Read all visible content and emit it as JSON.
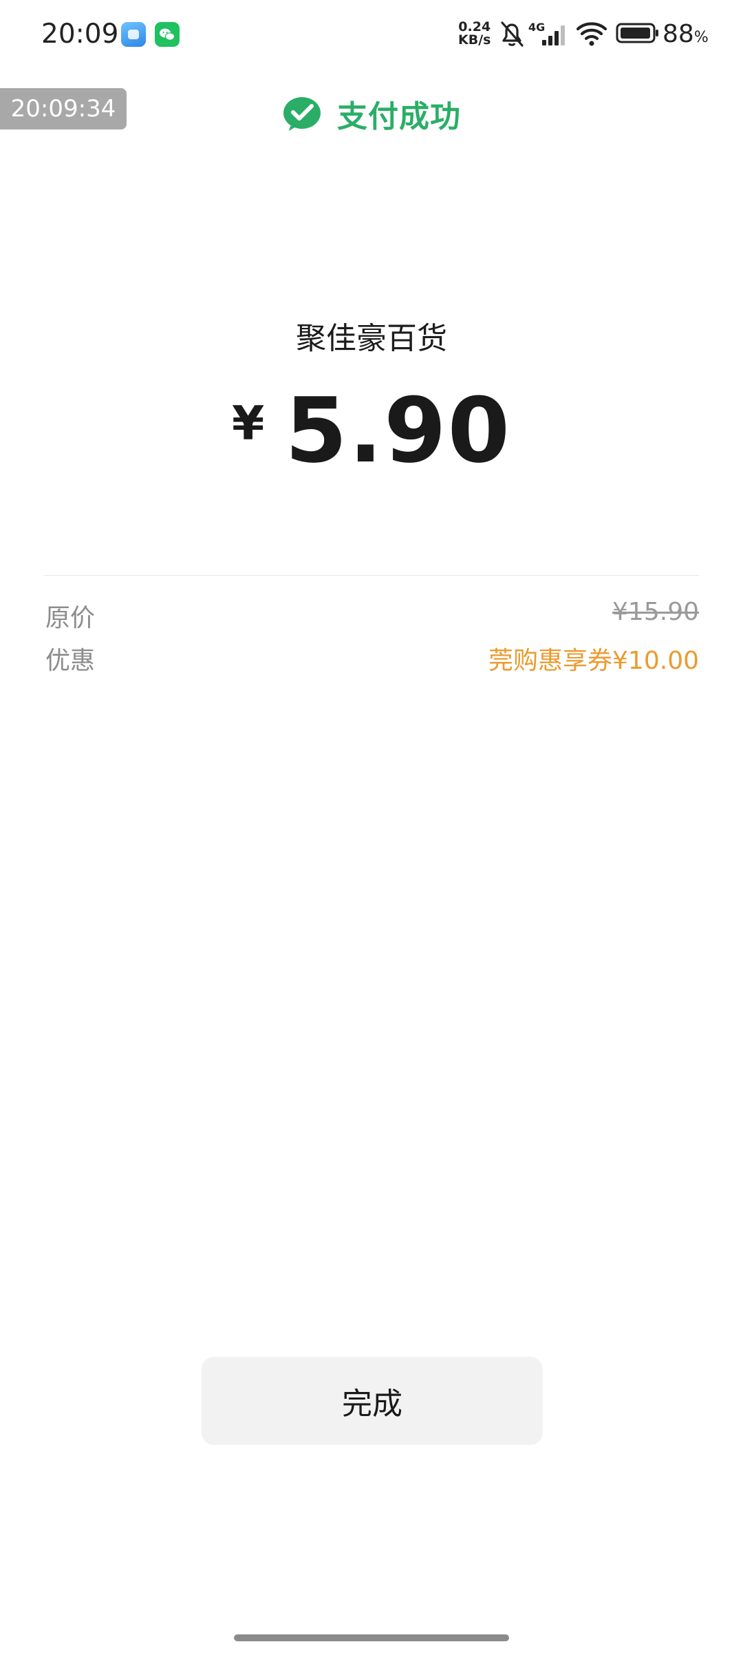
{
  "status_bar": {
    "time": "20:09",
    "net_speed_value": "0.24",
    "net_speed_unit": "KB/s",
    "network_type": "4G",
    "battery_level": "88",
    "battery_unit": "%",
    "icons": [
      "app-blue-icon",
      "wechat-icon",
      "bell-muted-icon",
      "signal-icon",
      "wifi-icon",
      "battery-icon"
    ]
  },
  "overlay_time": "20:09:34",
  "header": {
    "title": "支付成功",
    "icon": "check-circle-icon",
    "accent_color": "#2aae67"
  },
  "payment": {
    "merchant": "聚佳豪百货",
    "currency": "¥",
    "amount": "5.90"
  },
  "details": {
    "original_price_label": "原价",
    "original_price_value": "¥15.90",
    "discount_label": "优惠",
    "discount_value": "莞购惠享券¥10.00",
    "discount_color": "#ea9b30"
  },
  "actions": {
    "done_label": "完成"
  }
}
